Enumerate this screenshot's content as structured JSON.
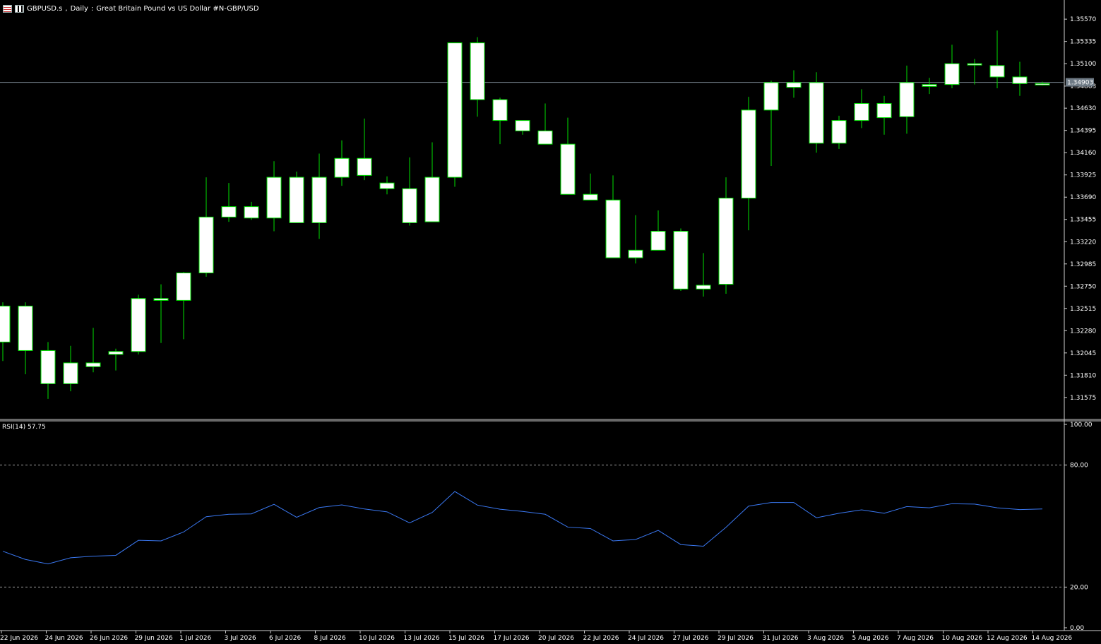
{
  "window": {
    "symbol": "GBPUSD.s",
    "timeframe": "Daily",
    "description": "Great Britain Pound vs US Dollar #N-GBP/USD"
  },
  "colors": {
    "background": "#000000",
    "candle_outline": "#00e000",
    "candle_fill": "#ffffff",
    "rsi_line": "#3a78f2",
    "axis_text": "#ffffff",
    "bid_line": "#7d8a95",
    "levels": "#9a9a9a"
  },
  "chart_data": [
    {
      "type": "candlestick",
      "price_axis": [
        "1.35570",
        "1.35335",
        "1.35100",
        "1.34863",
        "1.34630",
        "1.34395",
        "1.34160",
        "1.33925",
        "1.33690",
        "1.33455",
        "1.33220",
        "1.32985",
        "1.32750",
        "1.32515",
        "1.32280",
        "1.32045",
        "1.31810",
        "1.31575"
      ],
      "ylim": [
        1.3135,
        1.3575
      ],
      "current_price": "1.34903",
      "date_labels": [
        "22 Jun 2026",
        "24 Jun 2026",
        "26 Jun 2026",
        "29 Jun 2026",
        "1 Jul 2026",
        "3 Jul 2026",
        "6 Jul 2026",
        "8 Jul 2026",
        "10 Jul 2026",
        "13 Jul 2026",
        "15 Jul 2026",
        "17 Jul 2026",
        "20 Jul 2026",
        "22 Jul 2026",
        "24 Jul 2026",
        "27 Jul 2026",
        "29 Jul 2026",
        "31 Jul 2026",
        "3 Aug 2026",
        "5 Aug 2026",
        "7 Aug 2026",
        "10 Aug 2026",
        "12 Aug 2026",
        "14 Aug 2026"
      ],
      "ohlc": [
        [
          1.3216,
          1.3258,
          1.3196,
          1.3254
        ],
        [
          1.3254,
          1.3258,
          1.3182,
          1.3207
        ],
        [
          1.3207,
          1.3216,
          1.3156,
          1.3172
        ],
        [
          1.3172,
          1.3212,
          1.3164,
          1.3194
        ],
        [
          1.319,
          1.3231,
          1.3184,
          1.3194
        ],
        [
          1.3203,
          1.3209,
          1.3186,
          1.3206
        ],
        [
          1.3206,
          1.3266,
          1.3203,
          1.3262
        ],
        [
          1.3262,
          1.3277,
          1.3215,
          1.326
        ],
        [
          1.326,
          1.329,
          1.3219,
          1.3289
        ],
        [
          1.3289,
          1.339,
          1.3285,
          1.3348
        ],
        [
          1.3348,
          1.3384,
          1.3343,
          1.3359
        ],
        [
          1.3359,
          1.3364,
          1.3345,
          1.3347
        ],
        [
          1.3347,
          1.3407,
          1.3333,
          1.339
        ],
        [
          1.339,
          1.3396,
          1.3344,
          1.3342
        ],
        [
          1.3342,
          1.3415,
          1.3325,
          1.339
        ],
        [
          1.339,
          1.3429,
          1.3381,
          1.341
        ],
        [
          1.341,
          1.3452,
          1.3387,
          1.3392
        ],
        [
          1.3384,
          1.3391,
          1.3372,
          1.3378
        ],
        [
          1.3378,
          1.3411,
          1.3339,
          1.3342
        ],
        [
          1.3343,
          1.3427,
          1.3346,
          1.339
        ],
        [
          1.339,
          1.3458,
          1.338,
          1.3532
        ],
        [
          1.3532,
          1.3538,
          1.3454,
          1.3472
        ],
        [
          1.3472,
          1.3474,
          1.3425,
          1.345
        ],
        [
          1.345,
          1.3441,
          1.3435,
          1.3439
        ],
        [
          1.3439,
          1.3468,
          1.3428,
          1.3425
        ],
        [
          1.3425,
          1.3453,
          1.3416,
          1.3372
        ],
        [
          1.3372,
          1.3394,
          1.3371,
          1.3366
        ],
        [
          1.3366,
          1.3392,
          1.3336,
          1.3305
        ],
        [
          1.3305,
          1.335,
          1.3299,
          1.3313
        ],
        [
          1.3313,
          1.3355,
          1.3321,
          1.3333
        ],
        [
          1.3333,
          1.3336,
          1.327,
          1.3272
        ],
        [
          1.3272,
          1.331,
          1.3264,
          1.3276
        ],
        [
          1.3277,
          1.339,
          1.3267,
          1.3368
        ],
        [
          1.3368,
          1.3475,
          1.3334,
          1.3461
        ],
        [
          1.3461,
          1.3492,
          1.3402,
          1.349
        ],
        [
          1.349,
          1.3503,
          1.3474,
          1.3485
        ],
        [
          1.349,
          1.3501,
          1.3416,
          1.3426
        ],
        [
          1.3426,
          1.3455,
          1.342,
          1.345
        ],
        [
          1.345,
          1.3483,
          1.3442,
          1.3468
        ],
        [
          1.3468,
          1.3476,
          1.3435,
          1.3453
        ],
        [
          1.3454,
          1.3508,
          1.3436,
          1.349
        ],
        [
          1.3486,
          1.3495,
          1.3478,
          1.3488
        ],
        [
          1.3488,
          1.353,
          1.3484,
          1.351
        ],
        [
          1.351,
          1.3515,
          1.3488,
          1.3509
        ],
        [
          1.3508,
          1.3545,
          1.3484,
          1.3496
        ],
        [
          1.3496,
          1.3512,
          1.3476,
          1.3489
        ],
        [
          1.3489,
          1.3491,
          1.3487,
          1.3488
        ]
      ]
    },
    {
      "type": "line",
      "indicator": "RSI(14)",
      "value_label": "57.75",
      "ylim": [
        0,
        100
      ],
      "tick_labels": [
        "100.00",
        "80.00",
        "20.00",
        "0.00"
      ],
      "levels": [
        80,
        20
      ],
      "values": [
        37.6,
        33.6,
        31.4,
        34.4,
        35.2,
        35.6,
        43.0,
        42.7,
        47.1,
        54.6,
        55.8,
        56.0,
        60.7,
        54.3,
        59.1,
        60.4,
        58.4,
        57.0,
        51.6,
        56.7,
        67.0,
        60.3,
        58.3,
        57.2,
        55.8,
        49.5,
        48.8,
        42.7,
        43.4,
        47.9,
        40.9,
        40.1,
        49.4,
        59.8,
        61.6,
        61.6,
        54.1,
        56.3,
        58.0,
        56.3,
        59.6,
        59.0,
        61.0,
        60.8,
        59.0,
        58.1,
        58.4
      ]
    }
  ]
}
